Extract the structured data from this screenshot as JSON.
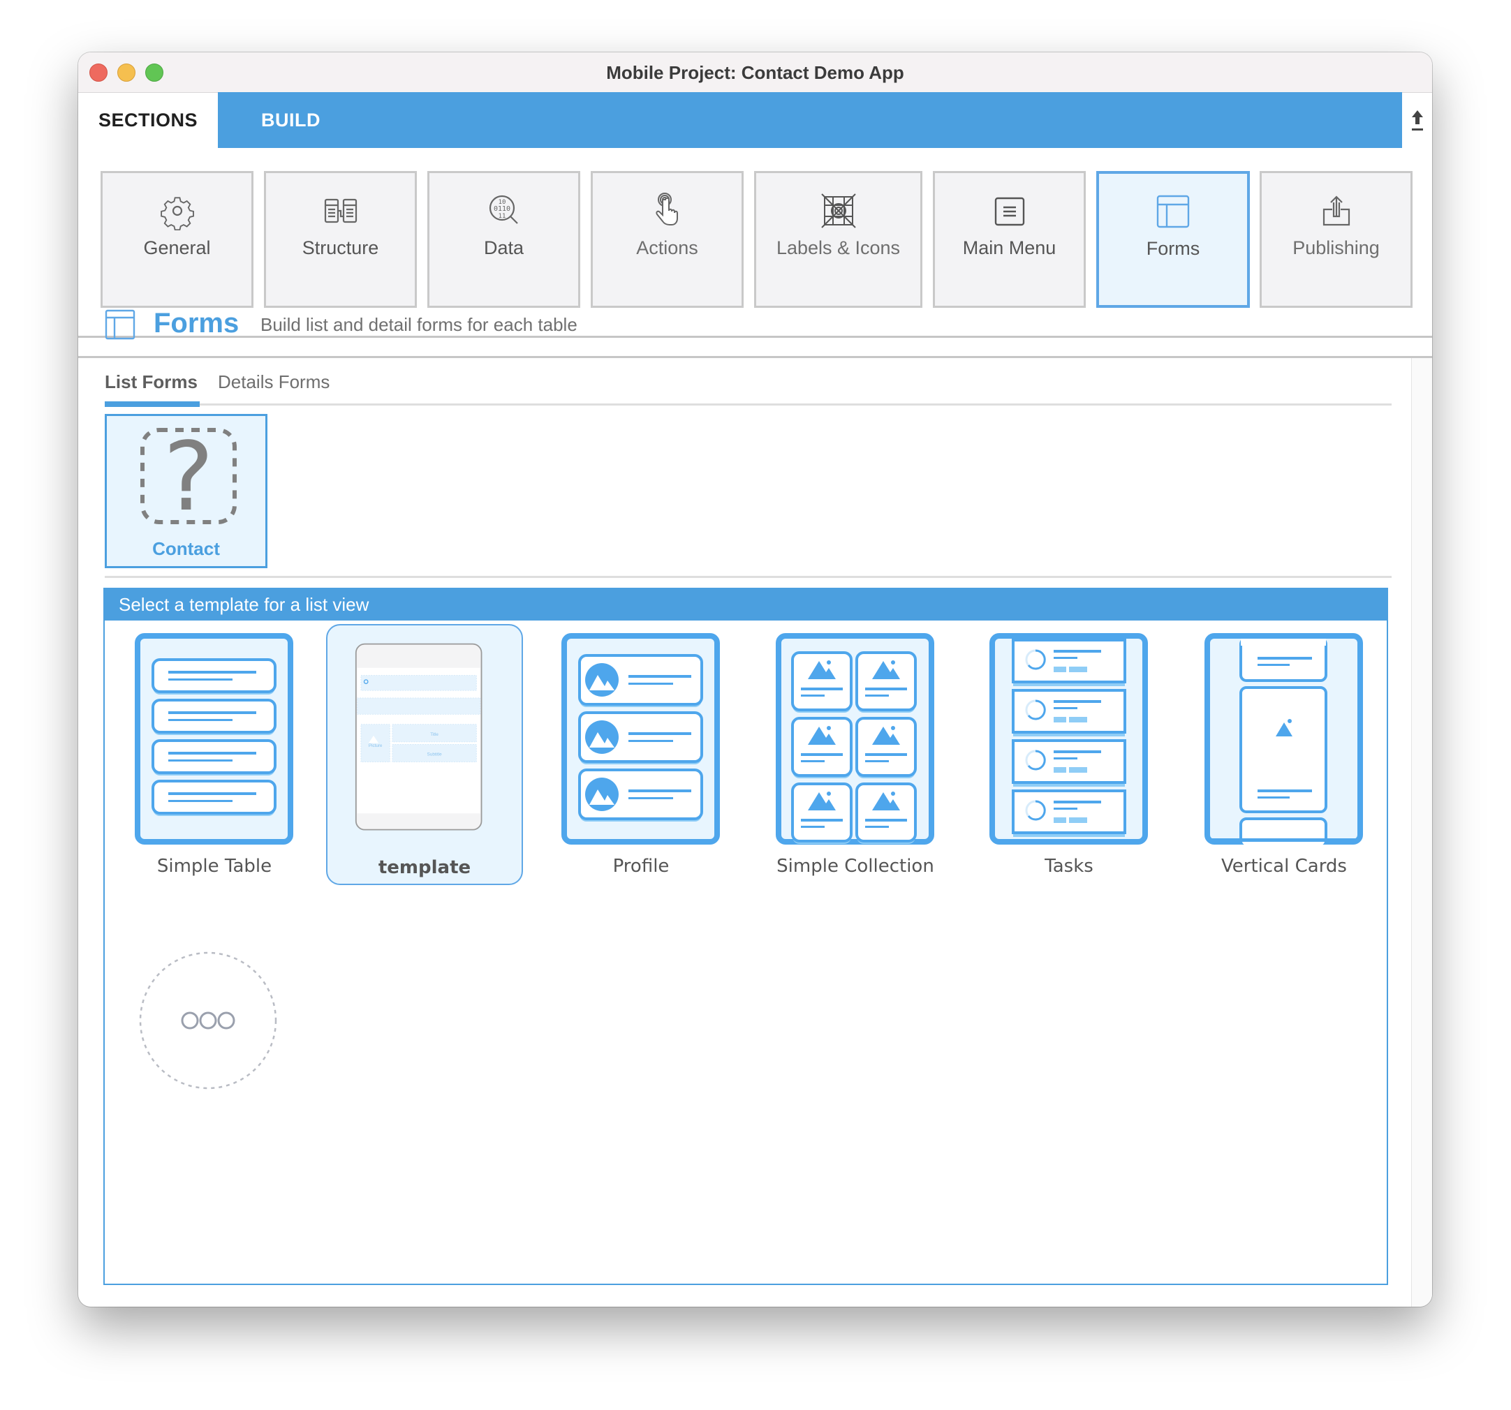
{
  "window": {
    "title": "Mobile Project: Contact Demo App"
  },
  "tabs": {
    "sections_label": "SECTIONS",
    "build_label": "BUILD",
    "active": "BUILD"
  },
  "toolbar": {
    "items": [
      {
        "label": "General",
        "icon": "gear-icon"
      },
      {
        "label": "Structure",
        "icon": "structure-icon"
      },
      {
        "label": "Data",
        "icon": "data-search-icon"
      },
      {
        "label": "Actions",
        "icon": "tap-hand-icon"
      },
      {
        "label": "Labels & Icons",
        "icon": "labels-icons-icon"
      },
      {
        "label": "Main Menu",
        "icon": "menu-icon"
      },
      {
        "label": "Forms",
        "icon": "forms-icon",
        "active": true
      },
      {
        "label": "Publishing",
        "icon": "share-upload-icon"
      }
    ]
  },
  "section": {
    "title": "Forms",
    "subtitle": "Build list and detail forms for each table"
  },
  "subtabs": {
    "list": "List Forms",
    "details": "Details Forms",
    "active": "List Forms"
  },
  "tables": [
    {
      "label": "Contact",
      "icon": "question-mark-icon",
      "selected": true
    }
  ],
  "templates": {
    "header": "Select a template for a list view",
    "items": [
      {
        "label": "Simple Table",
        "selected": false
      },
      {
        "label": "template",
        "selected": true,
        "preview": {
          "picture": "Picture",
          "title": "Title",
          "subtitle": "Subtitle"
        }
      },
      {
        "label": "Profile",
        "selected": false
      },
      {
        "label": "Simple Collection",
        "selected": false
      },
      {
        "label": "Tasks",
        "selected": false
      },
      {
        "label": "Vertical Cards",
        "selected": false
      }
    ],
    "more_icon": "more-options-icon"
  },
  "colors": {
    "accent": "#4b9fdf",
    "selected_bg": "#e8f5fe",
    "tile_bg": "#f3f3f5",
    "template_blue": "#4ea6ec"
  }
}
